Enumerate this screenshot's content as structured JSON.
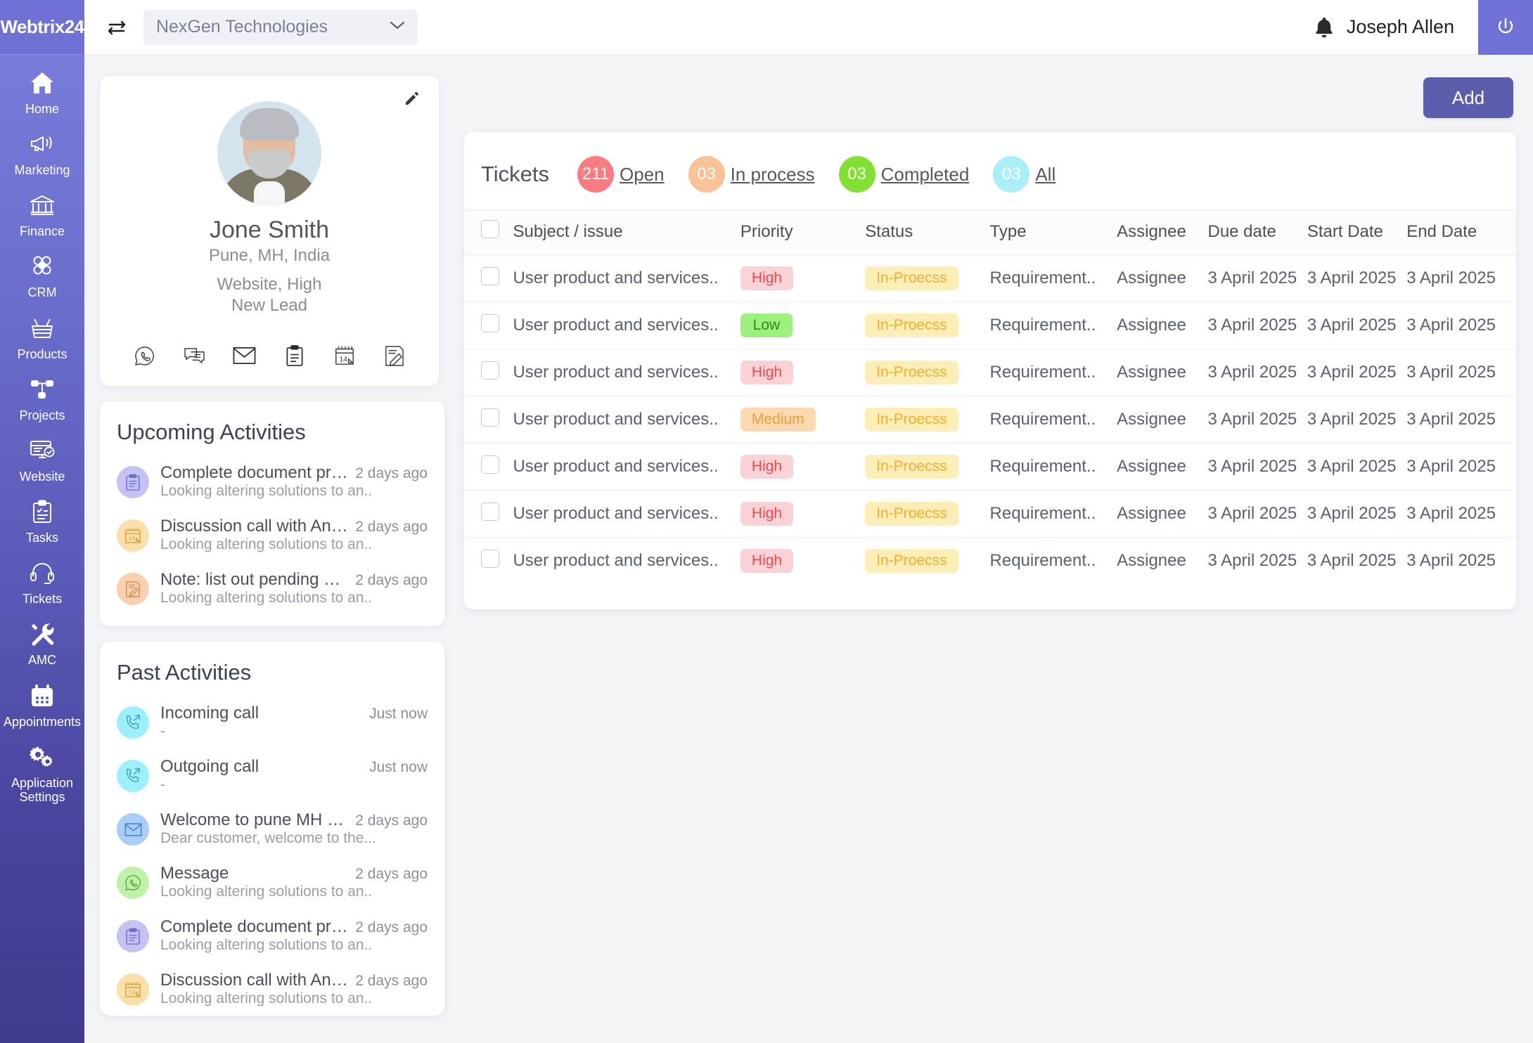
{
  "brand": {
    "name": "Webtrix24"
  },
  "topbar": {
    "swap_icon": "swap-arrows-icon",
    "company_selected": "NexGen Technologies",
    "company_caret": "chevron-down-icon",
    "bell_icon": "bell-icon",
    "user_name": "Joseph Allen",
    "power_icon": "power-icon"
  },
  "sidebar": {
    "items": [
      {
        "label": "Home",
        "icon": "home-icon"
      },
      {
        "label": "Marketing",
        "icon": "megaphone-icon"
      },
      {
        "label": "Finance",
        "icon": "bank-icon"
      },
      {
        "label": "CRM",
        "icon": "people-group-icon"
      },
      {
        "label": "Products",
        "icon": "basket-icon"
      },
      {
        "label": "Projects",
        "icon": "sitemap-icon"
      },
      {
        "label": "Website",
        "icon": "browser-check-icon"
      },
      {
        "label": "Tasks",
        "icon": "clipboard-check-icon"
      },
      {
        "label": "Tickets",
        "icon": "headset-icon"
      },
      {
        "label": "AMC",
        "icon": "tools-icon"
      },
      {
        "label": "Appointments",
        "icon": "calendar-icon"
      },
      {
        "label": "Application Settings",
        "icon": "gears-icon"
      }
    ]
  },
  "main": {
    "add_label": "Add"
  },
  "profile": {
    "edit_icon": "pencil-icon",
    "avatar": "user-photo",
    "name": "Jone Smith",
    "location": "Pune, MH, India",
    "source": "Website, High",
    "stage": "New Lead",
    "actions": [
      {
        "icon": "whatsapp-icon"
      },
      {
        "icon": "chat-icon"
      },
      {
        "icon": "email-icon"
      },
      {
        "icon": "clipboard-icon"
      },
      {
        "icon": "calendar-icon"
      },
      {
        "icon": "note-edit-icon"
      }
    ]
  },
  "upcoming": {
    "title": "Upcoming Activities",
    "items": [
      {
        "icon": "clipboard-icon",
        "bubble": "#c3c2f2",
        "glyph": "#6f6fd0",
        "name": "Complete document proces..",
        "time": "2 days ago",
        "sub": "Looking  altering solutions to an.."
      },
      {
        "icon": "calendar-icon",
        "bubble": "#fbdfa8",
        "glyph": "#d9a33b",
        "name": "Discussion call with Andy ..",
        "time": "2 days ago",
        "sub": "Looking  altering solutions to an.."
      },
      {
        "icon": "note-edit-icon",
        "bubble": "#fbd0ae",
        "glyph": "#d88a4e",
        "name": "Note: list out pending order..",
        "time": "2 days ago",
        "sub": "Looking  altering solutions to an.."
      }
    ]
  },
  "past": {
    "title": "Past Activities",
    "items": [
      {
        "icon": "incoming-call-icon",
        "bubble": "#9df0fb",
        "glyph": "#3ba7b8",
        "name": "Incoming call",
        "time": "Just now",
        "sub": "-"
      },
      {
        "icon": "outgoing-call-icon",
        "bubble": "#9df0fb",
        "glyph": "#3ba7b8",
        "name": "Outgoing call",
        "time": "Just now",
        "sub": "-"
      },
      {
        "icon": "email-icon",
        "bubble": "#a9cefa",
        "glyph": "#4c82c8",
        "name": "Welcome to pune MH cam...",
        "time": "2 days ago",
        "sub": "Dear customer, welcome to the..."
      },
      {
        "icon": "whatsapp-icon",
        "bubble": "#bdf2a8",
        "glyph": "#5aab42",
        "name": "Message",
        "time": "2 days ago",
        "sub": "Looking  altering solutions to an.."
      },
      {
        "icon": "clipboard-icon",
        "bubble": "#c3c2f2",
        "glyph": "#6f6fd0",
        "name": "Complete document proces..",
        "time": "2 days ago",
        "sub": "Looking  altering solutions to an.."
      },
      {
        "icon": "calendar-icon",
        "bubble": "#fbdfa8",
        "glyph": "#d9a33b",
        "name": "Discussion call with Andy ..",
        "time": "2 days ago",
        "sub": "Looking  altering solutions to an.."
      }
    ]
  },
  "tickets": {
    "title": "Tickets",
    "filters": [
      {
        "count": "211",
        "label": "Open",
        "color": "#fb7b82"
      },
      {
        "count": "03",
        "label": "In process",
        "color": "#fac196"
      },
      {
        "count": "03",
        "label": "Completed",
        "color": "#82e032"
      },
      {
        "count": "03",
        "label": "All",
        "color": "#aaeef8"
      }
    ],
    "columns": [
      "Subject / issue",
      "Priority",
      "Status",
      "Type",
      "Assignee",
      "Due date",
      "Start Date",
      "End Date"
    ],
    "rows": [
      {
        "subject": "User product and services..",
        "priority": "High",
        "priority_class": "badge-high",
        "status": "In-Proecss",
        "type": "Requirement..",
        "assignee": "Assignee",
        "due": "3 April 2025",
        "start": "3 April 2025",
        "end": "3 April 2025"
      },
      {
        "subject": "User product and services..",
        "priority": "Low",
        "priority_class": "badge-low",
        "status": "In-Proecss",
        "type": "Requirement..",
        "assignee": "Assignee",
        "due": "3 April 2025",
        "start": "3 April 2025",
        "end": "3 April 2025"
      },
      {
        "subject": "User product and services..",
        "priority": "High",
        "priority_class": "badge-high",
        "status": "In-Proecss",
        "type": "Requirement..",
        "assignee": "Assignee",
        "due": "3 April 2025",
        "start": "3 April 2025",
        "end": "3 April 2025"
      },
      {
        "subject": "User product and services..",
        "priority": "Medium",
        "priority_class": "badge-medium",
        "status": "In-Proecss",
        "type": "Requirement..",
        "assignee": "Assignee",
        "due": "3 April 2025",
        "start": "3 April 2025",
        "end": "3 April 2025"
      },
      {
        "subject": "User product and services..",
        "priority": "High",
        "priority_class": "badge-high",
        "status": "In-Proecss",
        "type": "Requirement..",
        "assignee": "Assignee",
        "due": "3 April 2025",
        "start": "3 April 2025",
        "end": "3 April 2025"
      },
      {
        "subject": "User product and services..",
        "priority": "High",
        "priority_class": "badge-high",
        "status": "In-Proecss",
        "type": "Requirement..",
        "assignee": "Assignee",
        "due": "3 April 2025",
        "start": "3 April 2025",
        "end": "3 April 2025"
      },
      {
        "subject": "User product and services..",
        "priority": "High",
        "priority_class": "badge-high",
        "status": "In-Proecss",
        "type": "Requirement..",
        "assignee": "Assignee",
        "due": "3 April 2025",
        "start": "3 April 2025",
        "end": "3 April 2025"
      }
    ]
  }
}
